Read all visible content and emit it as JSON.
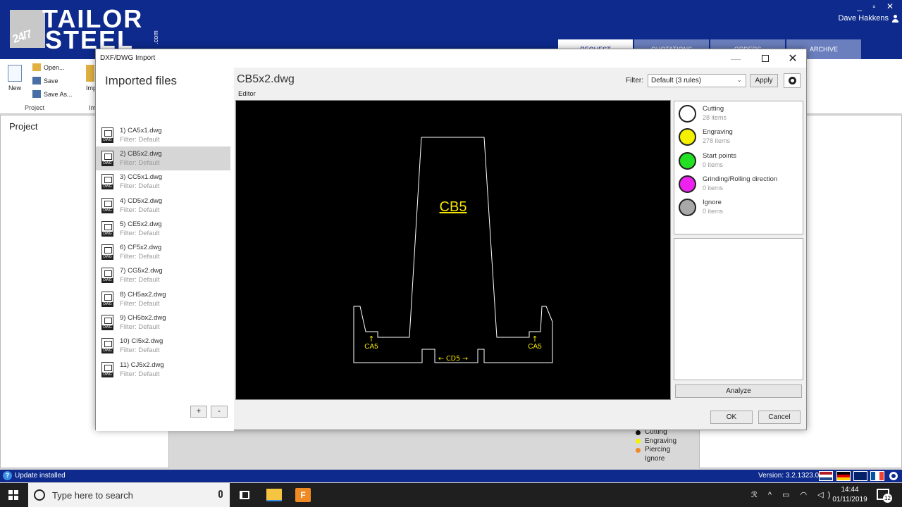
{
  "app": {
    "logo": {
      "badge": "24/7",
      "word1": "TAILOR",
      "word2": "STEEL",
      "suffix": ".com"
    },
    "user_name": "Dave Hakkens",
    "tabs": [
      "REQUEST",
      "QUOTATIONS",
      "ORDERS",
      "ARCHIVE"
    ],
    "ribbon": {
      "new_label": "New",
      "open_label": "Open...",
      "save_label": "Save",
      "save_as_label": "Save As...",
      "project_group": "Project",
      "import_label": "Imp",
      "import_group": "Im"
    },
    "project_panel_title": "Project",
    "legend": [
      {
        "label": "Cutting",
        "color": "#111111"
      },
      {
        "label": "Engraving",
        "color": "#f5f000"
      },
      {
        "label": "Piercing",
        "color": "#f08a24"
      },
      {
        "label": "Ignore",
        "color": "#d8d8d8"
      }
    ],
    "status": {
      "update": "Update installed",
      "version": "Version: 3.2.1323.0"
    }
  },
  "dialog": {
    "title": "DXF/DWG Import",
    "files_heading": "Imported files",
    "files": [
      {
        "name": "1) CA5x1.dwg",
        "filter": "Filter: Default"
      },
      {
        "name": "2) CB5x2.dwg",
        "filter": "Filter: Default",
        "selected": true
      },
      {
        "name": "3) CC5x1.dwg",
        "filter": "Filter: Default"
      },
      {
        "name": "4) CD5x2.dwg",
        "filter": "Filter: Default"
      },
      {
        "name": "5) CE5x2.dwg",
        "filter": "Filter: Default"
      },
      {
        "name": "6) CF5x2.dwg",
        "filter": "Filter: Default"
      },
      {
        "name": "7) CG5x2.dwg",
        "filter": "Filter: Default"
      },
      {
        "name": "8) CH5ax2.dwg",
        "filter": "Filter: Default"
      },
      {
        "name": "9) CH5bx2.dwg",
        "filter": "Filter: Default"
      },
      {
        "name": "10) CI5x2.dwg",
        "filter": "Filter: Default"
      },
      {
        "name": "11) CJ5x2.dwg",
        "filter": "Filter: Default"
      }
    ],
    "add_label": "+",
    "remove_label": "-",
    "current_file": "CB5x2.dwg",
    "filter_label": "Filter:",
    "filter_value": "Default (3 rules)",
    "apply_label": "Apply",
    "editor_label": "Editor",
    "drawing": {
      "main_label": "CB5",
      "left_label": "CA5",
      "right_label": "CA5",
      "bottom_label": "← CD5 →",
      "line_color": "#ffffff",
      "text_color": "#f5e600"
    },
    "layers": [
      {
        "name": "Cutting",
        "count": "28 items",
        "color": "#ffffff"
      },
      {
        "name": "Engraving",
        "count": "278 items",
        "color": "#f5f000"
      },
      {
        "name": "Start points",
        "count": "0 items",
        "color": "#22e022"
      },
      {
        "name": "Grinding/Rolling direction",
        "count": "0 items",
        "color": "#ee22ee"
      },
      {
        "name": "Ignore",
        "count": "0 items",
        "color": "#a8a8a8"
      }
    ],
    "analyze_label": "Analyze",
    "ok_label": "OK",
    "cancel_label": "Cancel"
  },
  "taskbar": {
    "search_placeholder": "Type here to search",
    "time": "14:44",
    "date": "01/11/2019",
    "notification_count": "12"
  }
}
